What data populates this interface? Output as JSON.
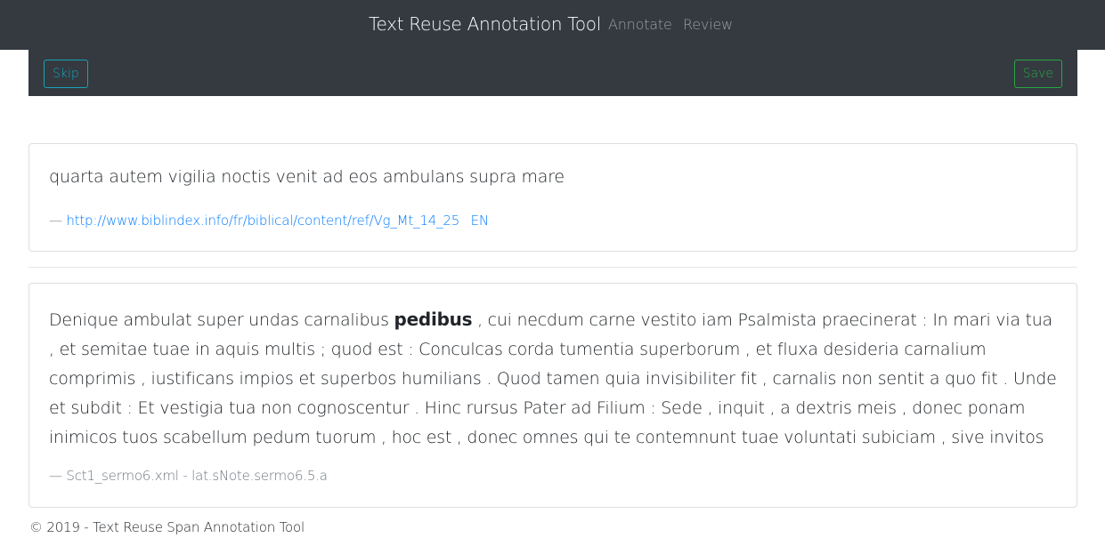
{
  "navbar": {
    "brand": "Text Reuse Annotation Tool",
    "links": [
      "Annotate",
      "Review"
    ]
  },
  "toolbar": {
    "skip_label": "Skip",
    "save_label": "Save"
  },
  "source": {
    "text": "quarta autem vigilia noctis venit ad eos ambulans supra mare",
    "dash": "—",
    "url": "http://www.biblindex.info/fr/biblical/content/ref/Vg_Mt_14_25",
    "lang": "EN"
  },
  "target": {
    "text_before": "Denique ambulat super undas carnalibus ",
    "highlight": "pedibus",
    "text_after": " , cui necdum carne vestito iam Psalmista praecinerat : In mari via tua , et semitae tuae in aquis multis ; quod est : Conculcas corda tumentia superborum , et fluxa desideria carnalium comprimis , iustificans impios et superbos humilians . Quod tamen quia invisibiliter fit , carnalis non sentit a quo fit . Unde et subdit : Et vestigia tua non cognoscentur . Hinc rursus Pater ad Filium : Sede , inquit , a dextris meis , donec ponam inimicos tuos scabellum pedum tuorum , hoc est , donec omnes qui te contemnunt tuae voluntati subiciam , sive invitos",
    "citation": "— Sct1_sermo6.xml - lat.sNote.sermo6.5.a"
  },
  "footer": {
    "text": "© 2019 - Text Reuse Span Annotation Tool"
  },
  "colors": {
    "navbar_bg": "#343a40",
    "skip": "#17a2b8",
    "save": "#28a745",
    "link": "#007bff"
  }
}
